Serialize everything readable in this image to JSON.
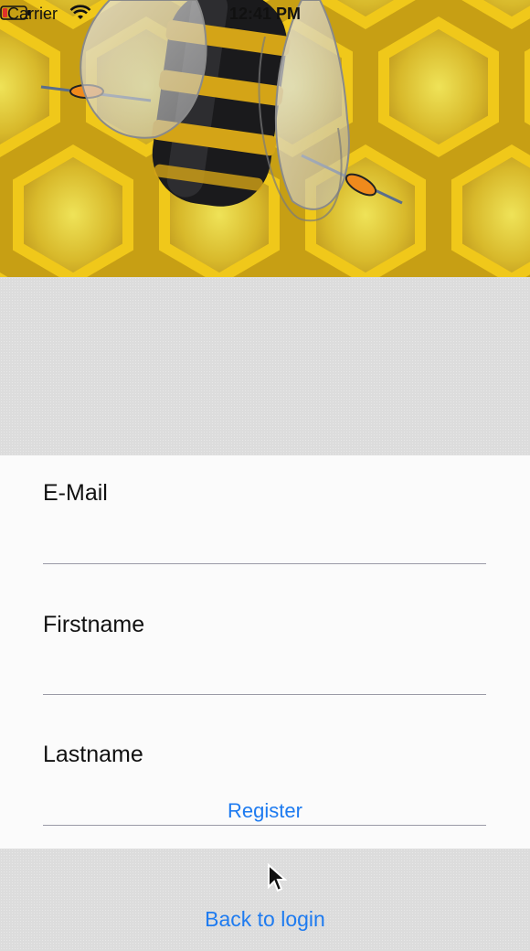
{
  "status_bar": {
    "carrier": "Carrier",
    "time": "12:41 PM"
  },
  "form": {
    "email_label": "E-Mail",
    "firstname_label": "Firstname",
    "lastname_label": "Lastname",
    "register_label": "Register"
  },
  "footer": {
    "back_to_login_label": "Back to login"
  },
  "colors": {
    "accent": "#1e7bf0",
    "honeycomb": "#d9b62b",
    "battery_low": "#e0312a"
  },
  "icons": {
    "wifi": "wifi-icon",
    "battery": "battery-icon",
    "cursor": "mouse-pointer-icon"
  }
}
